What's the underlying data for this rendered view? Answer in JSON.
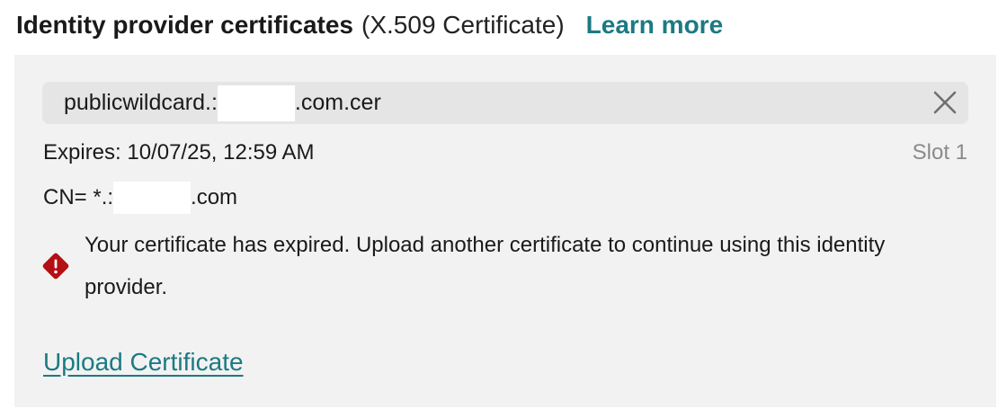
{
  "header": {
    "title": "Identity provider certificates",
    "subtitle": "(X.509 Certificate)",
    "learn_more": "Learn more"
  },
  "certificate": {
    "file_name_prefix": "publicwildcard.:",
    "file_name_suffix": ".com.cer",
    "expires": "Expires: 10/07/25, 12:59 AM",
    "slot": "Slot 1",
    "cn_prefix": "CN= *.:",
    "cn_suffix": ".com",
    "clear_icon": "close-icon"
  },
  "warning": {
    "icon": "error-diamond-icon",
    "icon_color": "#b40f14",
    "message": "Your certificate has expired. Upload another certificate to continue using this identity provider."
  },
  "actions": {
    "upload_label": "Upload Certificate"
  },
  "colors": {
    "accent": "#1b7a83",
    "panel_bg": "#f2f2f2",
    "field_bg": "#e5e5e5",
    "muted_text": "#8a8a8a"
  }
}
